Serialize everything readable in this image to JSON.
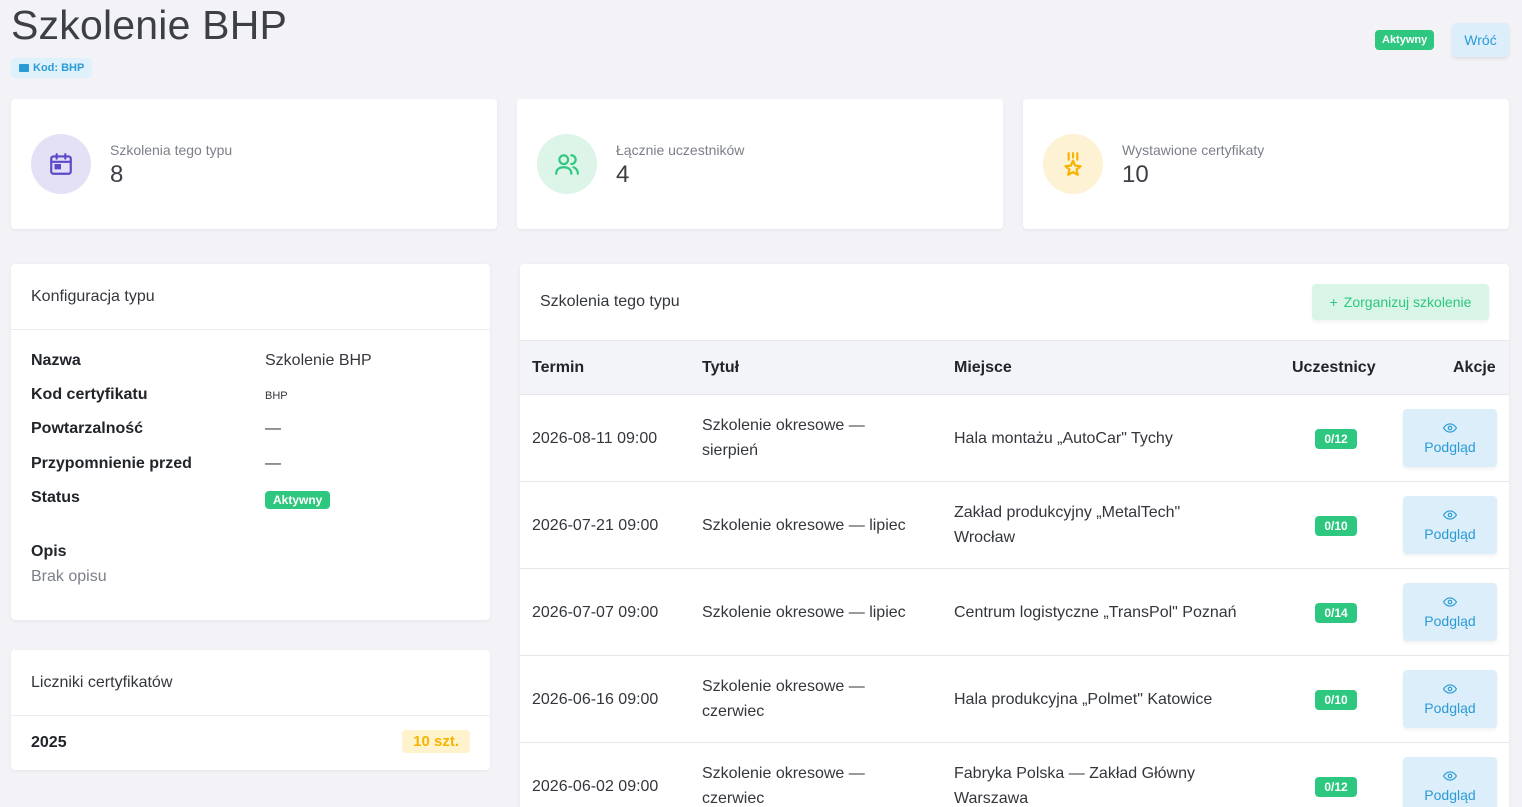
{
  "header": {
    "title": "Szkolenie BHP",
    "code_badge": "Kod: BHP",
    "status": "Aktywny",
    "back_label": "Wróć"
  },
  "stats": [
    {
      "label": "Szkolenia tego typu",
      "value": "8",
      "icon": "calendar-icon",
      "bg": "#e4e1f7",
      "fg": "#5a49c9"
    },
    {
      "label": "Łącznie uczestników",
      "value": "4",
      "icon": "users-icon",
      "bg": "#ddf4e8",
      "fg": "#2dc77f"
    },
    {
      "label": "Wystawione certyfikaty",
      "value": "10",
      "icon": "award-icon",
      "bg": "#fdf2d4",
      "fg": "#f5b400"
    }
  ],
  "config": {
    "title": "Konfiguracja typu",
    "rows": [
      {
        "key": "Nazwa",
        "value": "Szkolenie BHP"
      },
      {
        "key": "Kod certyfikatu",
        "value": "BHP"
      },
      {
        "key": "Powtarzalność",
        "value": "—"
      },
      {
        "key": "Przypomnienie przed",
        "value": "—"
      },
      {
        "key": "Status",
        "value": "Aktywny"
      }
    ],
    "description_label": "Opis",
    "description_value": "Brak opisu"
  },
  "counters": {
    "title": "Liczniki certyfikatów",
    "year": "2025",
    "count": "10 szt."
  },
  "trainings": {
    "title": "Szkolenia tego typu",
    "organize_label": "Zorganizuj szkolenie",
    "columns": [
      "Termin",
      "Tytuł",
      "Miejsce",
      "Uczestnicy",
      "Akcje"
    ],
    "view_label": "Podgląd",
    "rows": [
      {
        "date": "2026-08-11 09:00",
        "title1": "Szkolenie okresowe —",
        "title2": "sierpień",
        "place1": "Hala montażu „AutoCar\" Tychy",
        "place2": "",
        "participants": "0/12"
      },
      {
        "date": "2026-07-21 09:00",
        "title1": "Szkolenie okresowe — lipiec",
        "title2": "",
        "place1": "Zakład produkcyjny „MetalTech\"",
        "place2": "Wrocław",
        "participants": "0/10"
      },
      {
        "date": "2026-07-07 09:00",
        "title1": "Szkolenie okresowe — lipiec",
        "title2": "",
        "place1": "Centrum logistyczne „TransPol\" Poznań",
        "place2": "",
        "participants": "0/14"
      },
      {
        "date": "2026-06-16 09:00",
        "title1": "Szkolenie okresowe —",
        "title2": "czerwiec",
        "place1": "Hala produkcyjna „Polmet\" Katowice",
        "place2": "",
        "participants": "0/10"
      },
      {
        "date": "2026-06-02 09:00",
        "title1": "Szkolenie okresowe —",
        "title2": "czerwiec",
        "place1": "Fabryka Polska — Zakład Główny",
        "place2": "Warszawa",
        "participants": "0/12"
      }
    ]
  }
}
